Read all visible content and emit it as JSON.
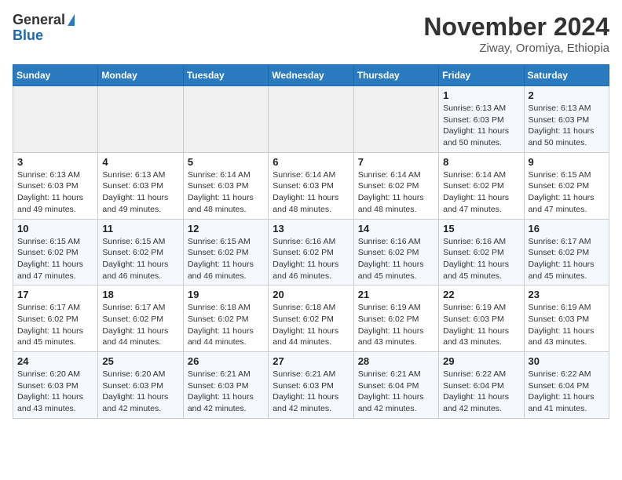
{
  "header": {
    "logo_general": "General",
    "logo_blue": "Blue",
    "month_year": "November 2024",
    "location": "Ziway, Oromiya, Ethiopia"
  },
  "weekdays": [
    "Sunday",
    "Monday",
    "Tuesday",
    "Wednesday",
    "Thursday",
    "Friday",
    "Saturday"
  ],
  "weeks": [
    [
      {
        "day": "",
        "info": ""
      },
      {
        "day": "",
        "info": ""
      },
      {
        "day": "",
        "info": ""
      },
      {
        "day": "",
        "info": ""
      },
      {
        "day": "",
        "info": ""
      },
      {
        "day": "1",
        "info": "Sunrise: 6:13 AM\nSunset: 6:03 PM\nDaylight: 11 hours and 50 minutes."
      },
      {
        "day": "2",
        "info": "Sunrise: 6:13 AM\nSunset: 6:03 PM\nDaylight: 11 hours and 50 minutes."
      }
    ],
    [
      {
        "day": "3",
        "info": "Sunrise: 6:13 AM\nSunset: 6:03 PM\nDaylight: 11 hours and 49 minutes."
      },
      {
        "day": "4",
        "info": "Sunrise: 6:13 AM\nSunset: 6:03 PM\nDaylight: 11 hours and 49 minutes."
      },
      {
        "day": "5",
        "info": "Sunrise: 6:14 AM\nSunset: 6:03 PM\nDaylight: 11 hours and 48 minutes."
      },
      {
        "day": "6",
        "info": "Sunrise: 6:14 AM\nSunset: 6:03 PM\nDaylight: 11 hours and 48 minutes."
      },
      {
        "day": "7",
        "info": "Sunrise: 6:14 AM\nSunset: 6:02 PM\nDaylight: 11 hours and 48 minutes."
      },
      {
        "day": "8",
        "info": "Sunrise: 6:14 AM\nSunset: 6:02 PM\nDaylight: 11 hours and 47 minutes."
      },
      {
        "day": "9",
        "info": "Sunrise: 6:15 AM\nSunset: 6:02 PM\nDaylight: 11 hours and 47 minutes."
      }
    ],
    [
      {
        "day": "10",
        "info": "Sunrise: 6:15 AM\nSunset: 6:02 PM\nDaylight: 11 hours and 47 minutes."
      },
      {
        "day": "11",
        "info": "Sunrise: 6:15 AM\nSunset: 6:02 PM\nDaylight: 11 hours and 46 minutes."
      },
      {
        "day": "12",
        "info": "Sunrise: 6:15 AM\nSunset: 6:02 PM\nDaylight: 11 hours and 46 minutes."
      },
      {
        "day": "13",
        "info": "Sunrise: 6:16 AM\nSunset: 6:02 PM\nDaylight: 11 hours and 46 minutes."
      },
      {
        "day": "14",
        "info": "Sunrise: 6:16 AM\nSunset: 6:02 PM\nDaylight: 11 hours and 45 minutes."
      },
      {
        "day": "15",
        "info": "Sunrise: 6:16 AM\nSunset: 6:02 PM\nDaylight: 11 hours and 45 minutes."
      },
      {
        "day": "16",
        "info": "Sunrise: 6:17 AM\nSunset: 6:02 PM\nDaylight: 11 hours and 45 minutes."
      }
    ],
    [
      {
        "day": "17",
        "info": "Sunrise: 6:17 AM\nSunset: 6:02 PM\nDaylight: 11 hours and 45 minutes."
      },
      {
        "day": "18",
        "info": "Sunrise: 6:17 AM\nSunset: 6:02 PM\nDaylight: 11 hours and 44 minutes."
      },
      {
        "day": "19",
        "info": "Sunrise: 6:18 AM\nSunset: 6:02 PM\nDaylight: 11 hours and 44 minutes."
      },
      {
        "day": "20",
        "info": "Sunrise: 6:18 AM\nSunset: 6:02 PM\nDaylight: 11 hours and 44 minutes."
      },
      {
        "day": "21",
        "info": "Sunrise: 6:19 AM\nSunset: 6:02 PM\nDaylight: 11 hours and 43 minutes."
      },
      {
        "day": "22",
        "info": "Sunrise: 6:19 AM\nSunset: 6:03 PM\nDaylight: 11 hours and 43 minutes."
      },
      {
        "day": "23",
        "info": "Sunrise: 6:19 AM\nSunset: 6:03 PM\nDaylight: 11 hours and 43 minutes."
      }
    ],
    [
      {
        "day": "24",
        "info": "Sunrise: 6:20 AM\nSunset: 6:03 PM\nDaylight: 11 hours and 43 minutes."
      },
      {
        "day": "25",
        "info": "Sunrise: 6:20 AM\nSunset: 6:03 PM\nDaylight: 11 hours and 42 minutes."
      },
      {
        "day": "26",
        "info": "Sunrise: 6:21 AM\nSunset: 6:03 PM\nDaylight: 11 hours and 42 minutes."
      },
      {
        "day": "27",
        "info": "Sunrise: 6:21 AM\nSunset: 6:03 PM\nDaylight: 11 hours and 42 minutes."
      },
      {
        "day": "28",
        "info": "Sunrise: 6:21 AM\nSunset: 6:04 PM\nDaylight: 11 hours and 42 minutes."
      },
      {
        "day": "29",
        "info": "Sunrise: 6:22 AM\nSunset: 6:04 PM\nDaylight: 11 hours and 42 minutes."
      },
      {
        "day": "30",
        "info": "Sunrise: 6:22 AM\nSunset: 6:04 PM\nDaylight: 11 hours and 41 minutes."
      }
    ]
  ]
}
